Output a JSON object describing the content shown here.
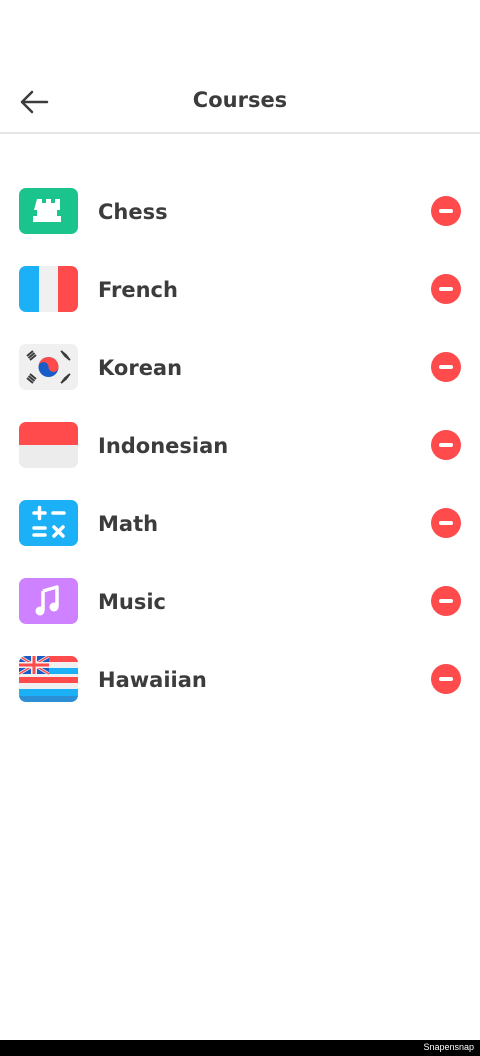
{
  "header": {
    "title": "Courses",
    "back_icon": "arrow-left-icon"
  },
  "colors": {
    "remove": "#ff4b4b",
    "text": "#3c3c3c",
    "divider": "#e5e5e5"
  },
  "courses": [
    {
      "label": "Chess",
      "icon": "chess-rook-icon"
    },
    {
      "label": "French",
      "icon": "france-flag-icon"
    },
    {
      "label": "Korean",
      "icon": "korea-flag-icon"
    },
    {
      "label": "Indonesian",
      "icon": "indonesia-flag-icon"
    },
    {
      "label": "Math",
      "icon": "math-operators-icon"
    },
    {
      "label": "Music",
      "icon": "music-note-icon"
    },
    {
      "label": "Hawaiian",
      "icon": "hawaii-flag-icon"
    }
  ],
  "footer": {
    "watermark": "Snapensnap"
  }
}
